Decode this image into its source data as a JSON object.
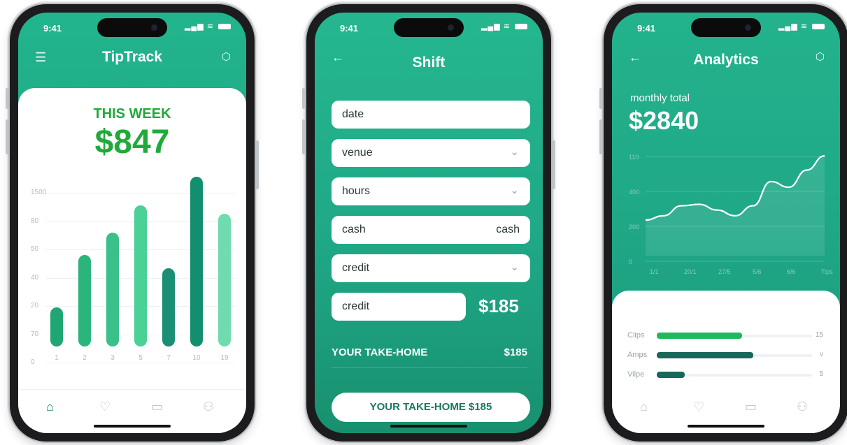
{
  "status": {
    "time": "9:41"
  },
  "screen1": {
    "title": "TipTrack",
    "week_label": "THIS WEEK",
    "week_amount": "$847",
    "y_ticks": [
      "1500",
      "80",
      "50",
      "40",
      "20",
      "70",
      "0"
    ],
    "colors": {
      "accent": "#1faa3a",
      "bars": [
        "#1fa673",
        "#2bb57d",
        "#3ac08a",
        "#49d196",
        "#1b8f74",
        "#138f6f",
        "#6fdcb0"
      ]
    },
    "chart_data": {
      "type": "bar",
      "categories": [
        "1",
        "2",
        "3",
        "5",
        "7",
        "10",
        "19"
      ],
      "values": [
        23,
        54,
        67,
        83,
        46,
        100,
        78
      ],
      "ylim": [
        0,
        100
      ]
    },
    "tabs": [
      {
        "icon": "home-icon",
        "glyph": "⌂"
      },
      {
        "icon": "heart-icon",
        "glyph": "♡"
      },
      {
        "icon": "chat-icon",
        "glyph": "▭"
      },
      {
        "icon": "profile-icon",
        "glyph": "⚇"
      }
    ]
  },
  "screen2": {
    "title": "Shift",
    "fields": [
      {
        "label": "date",
        "right": "",
        "chevron": false
      },
      {
        "label": "venue",
        "right": "",
        "chevron": true
      },
      {
        "label": "hours",
        "right": "",
        "chevron": true
      },
      {
        "label": "cash",
        "right": "cash",
        "chevron": false
      },
      {
        "label": "credit",
        "right": "",
        "chevron": true
      },
      {
        "label": "credit",
        "right": "",
        "chevron": false
      }
    ],
    "credit_amount": "$185",
    "takehome_label": "YOUR TAKE-HOME",
    "takehome_value": "$185",
    "cta_label": "YOUR TAKE-HOME $185"
  },
  "screen3": {
    "title": "Analytics",
    "monthly_label": "monthly total",
    "monthly_total": "$2840",
    "chart_data": {
      "type": "area",
      "y_ticks": [
        "110",
        "400",
        "200",
        "0"
      ],
      "x_ticks": [
        "1/1",
        "20/1",
        "27/5",
        "5/6",
        "6/6",
        "Tips"
      ],
      "x": [
        0,
        1,
        2,
        3,
        4,
        5,
        6
      ],
      "values": [
        38,
        52,
        47,
        68,
        62,
        78,
        0
      ],
      "series_points": [
        [
          0,
          25
        ],
        [
          1,
          28
        ],
        [
          2,
          35
        ],
        [
          3,
          36
        ],
        [
          4,
          32
        ],
        [
          5,
          28
        ],
        [
          6,
          35
        ],
        [
          7,
          52
        ],
        [
          8,
          48
        ],
        [
          9,
          60
        ],
        [
          10,
          70
        ]
      ],
      "ylim": [
        0,
        80
      ]
    },
    "progress": [
      {
        "label": "Clips",
        "value": 0.55,
        "value_text": "15",
        "color": "#1fb85e"
      },
      {
        "label": "Amps",
        "value": 0.62,
        "value_text": "v",
        "color": "#17685a"
      },
      {
        "label": "Vilpe",
        "value": 0.18,
        "value_text": "5",
        "color": "#17685a"
      }
    ],
    "tabs": [
      {
        "icon": "home-icon",
        "glyph": "⌂"
      },
      {
        "icon": "heart-icon",
        "glyph": "♡"
      },
      {
        "icon": "chat-icon",
        "glyph": "▭"
      },
      {
        "icon": "profile-icon",
        "glyph": "⚇"
      }
    ]
  }
}
